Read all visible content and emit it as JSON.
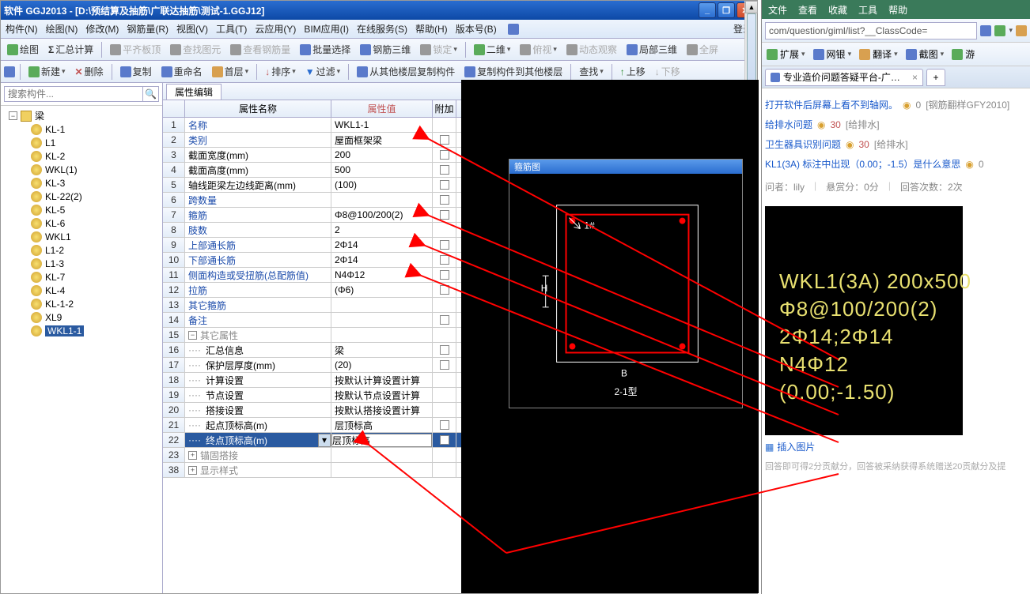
{
  "title": "软件 GGJ2013 - [D:\\预结算及抽筋\\广联达抽筋\\测试-1.GGJ12]",
  "menu": [
    "构件(N)",
    "绘图(N)",
    "修改(M)",
    "钢筋量(R)",
    "视图(V)",
    "工具(T)",
    "云应用(Y)",
    "BIM应用(I)",
    "在线服务(S)",
    "帮助(H)",
    "版本号(B)"
  ],
  "login": "登录",
  "tb1": {
    "draw": "绘图",
    "sum": "汇总计算",
    "level": "平齐板顶",
    "find": "查找图元",
    "rebar": "查看钢筋量",
    "batch": "批量选择",
    "tri": "钢筋三维",
    "lock": "锁定",
    "dim": "二维",
    "top": "俯视",
    "anim": "动态观察",
    "part": "局部三维",
    "full": "全屏"
  },
  "tb2": {
    "new": "新建",
    "del": "删除",
    "copy": "复制",
    "rename": "重命名",
    "floor": "首层",
    "sort": "排序",
    "filter": "过滤",
    "copyFrom": "从其他楼层复制构件",
    "copyTo": "复制构件到其他楼层",
    "search": "查找",
    "up": "上移",
    "down": "下移"
  },
  "searchPlaceholder": "搜索构件...",
  "tree": {
    "root": "梁",
    "items": [
      "KL-1",
      "L1",
      "KL-2",
      "WKL(1)",
      "KL-3",
      "KL-22(2)",
      "KL-5",
      "KL-6",
      "WKL1",
      "L1-2",
      "L1-3",
      "KL-7",
      "KL-4",
      "KL-1-2",
      "XL9",
      "WKL1-1"
    ],
    "selected": "WKL1-1"
  },
  "propTab": "属性编辑",
  "propHeader": {
    "name": "属性名称",
    "val": "属性值",
    "add": "附加"
  },
  "rows": [
    {
      "n": 1,
      "name": "名称",
      "val": "WKL1-1",
      "chk": false,
      "link": true
    },
    {
      "n": 2,
      "name": "类别",
      "val": "屋面框架梁",
      "chk": true,
      "link": true
    },
    {
      "n": 3,
      "name": "截面宽度(mm)",
      "val": "200",
      "chk": true,
      "link": false
    },
    {
      "n": 4,
      "name": "截面高度(mm)",
      "val": "500",
      "chk": true,
      "link": false
    },
    {
      "n": 5,
      "name": "轴线距梁左边线距离(mm)",
      "val": "(100)",
      "chk": true,
      "link": false
    },
    {
      "n": 6,
      "name": "跨数量",
      "val": "",
      "chk": true,
      "link": true
    },
    {
      "n": 7,
      "name": "箍筋",
      "val": "Φ8@100/200(2)",
      "chk": true,
      "link": true
    },
    {
      "n": 8,
      "name": "肢数",
      "val": "2",
      "chk": false,
      "link": true
    },
    {
      "n": 9,
      "name": "上部通长筋",
      "val": "2Φ14",
      "chk": true,
      "link": true
    },
    {
      "n": 10,
      "name": "下部通长筋",
      "val": "2Φ14",
      "chk": true,
      "link": true
    },
    {
      "n": 11,
      "name": "侧面构造或受扭筋(总配筋值)",
      "val": "N4Φ12",
      "chk": true,
      "link": true
    },
    {
      "n": 12,
      "name": "拉筋",
      "val": "(Φ6)",
      "chk": true,
      "link": true
    },
    {
      "n": 13,
      "name": "其它箍筋",
      "val": "",
      "chk": false,
      "link": true
    },
    {
      "n": 14,
      "name": "备注",
      "val": "",
      "chk": true,
      "link": true
    }
  ],
  "group1": {
    "n": 15,
    "name": "其它属性"
  },
  "rows2": [
    {
      "n": 16,
      "name": "汇总信息",
      "val": "梁",
      "chk": true
    },
    {
      "n": 17,
      "name": "保护层厚度(mm)",
      "val": "(20)",
      "chk": true
    },
    {
      "n": 18,
      "name": "计算设置",
      "val": "按默认计算设置计算",
      "chk": false
    },
    {
      "n": 19,
      "name": "节点设置",
      "val": "按默认节点设置计算",
      "chk": false
    },
    {
      "n": 20,
      "name": "搭接设置",
      "val": "按默认搭接设置计算",
      "chk": false
    },
    {
      "n": 21,
      "name": "起点顶标高(m)",
      "val": "层顶标高",
      "chk": true
    }
  ],
  "rowSel": {
    "n": 22,
    "name": "终点顶标高(m)",
    "val": "层顶标高"
  },
  "group2": {
    "n": 23,
    "name": "锚固搭接"
  },
  "group3": {
    "n": 38,
    "name": "显示样式"
  },
  "rebarTitle": "箍筋图",
  "rebarLabels": {
    "tag": "1#",
    "dim": "B",
    "type": "2-1型",
    "side": "H"
  },
  "browser": {
    "menu": [
      "文件",
      "查看",
      "收藏",
      "工具",
      "帮助"
    ],
    "url": "com/question/giml/list?__ClassCode=",
    "ext": "扩展",
    "bank": "网银",
    "trans": "翻译",
    "shot": "截图",
    "you": "游",
    "tabTitle": "专业造价问题答疑平台-广联达",
    "q1": {
      "text": "打开软件后屏幕上看不到轴网。",
      "pts": "0",
      "cat": "[钢筋翻样GFY2010]"
    },
    "q2": {
      "text": "给排水问题",
      "pts": "30",
      "cat": "[给排水]"
    },
    "q3": {
      "text": "卫生器具识别问题",
      "pts": "30",
      "cat": "[给排水]"
    },
    "q4": {
      "text": "KL1(3A) 标注中出现（0.00；-1.5）是什么意思",
      "pts": "0"
    },
    "info": {
      "asker": "问者：lily",
      "reward": "悬赏分：0分",
      "answers": "回答次数：2次"
    },
    "cad": [
      "WKL1(3A) 200x500",
      "Φ8@100/200(2)",
      "2Φ14;2Φ14",
      "N4Φ12",
      "(0.00;-1.50)"
    ],
    "insert": "插入图片",
    "footer": "回答即可得2分贡献分，回答被采纳获得系统赠送20贡献分及提"
  }
}
